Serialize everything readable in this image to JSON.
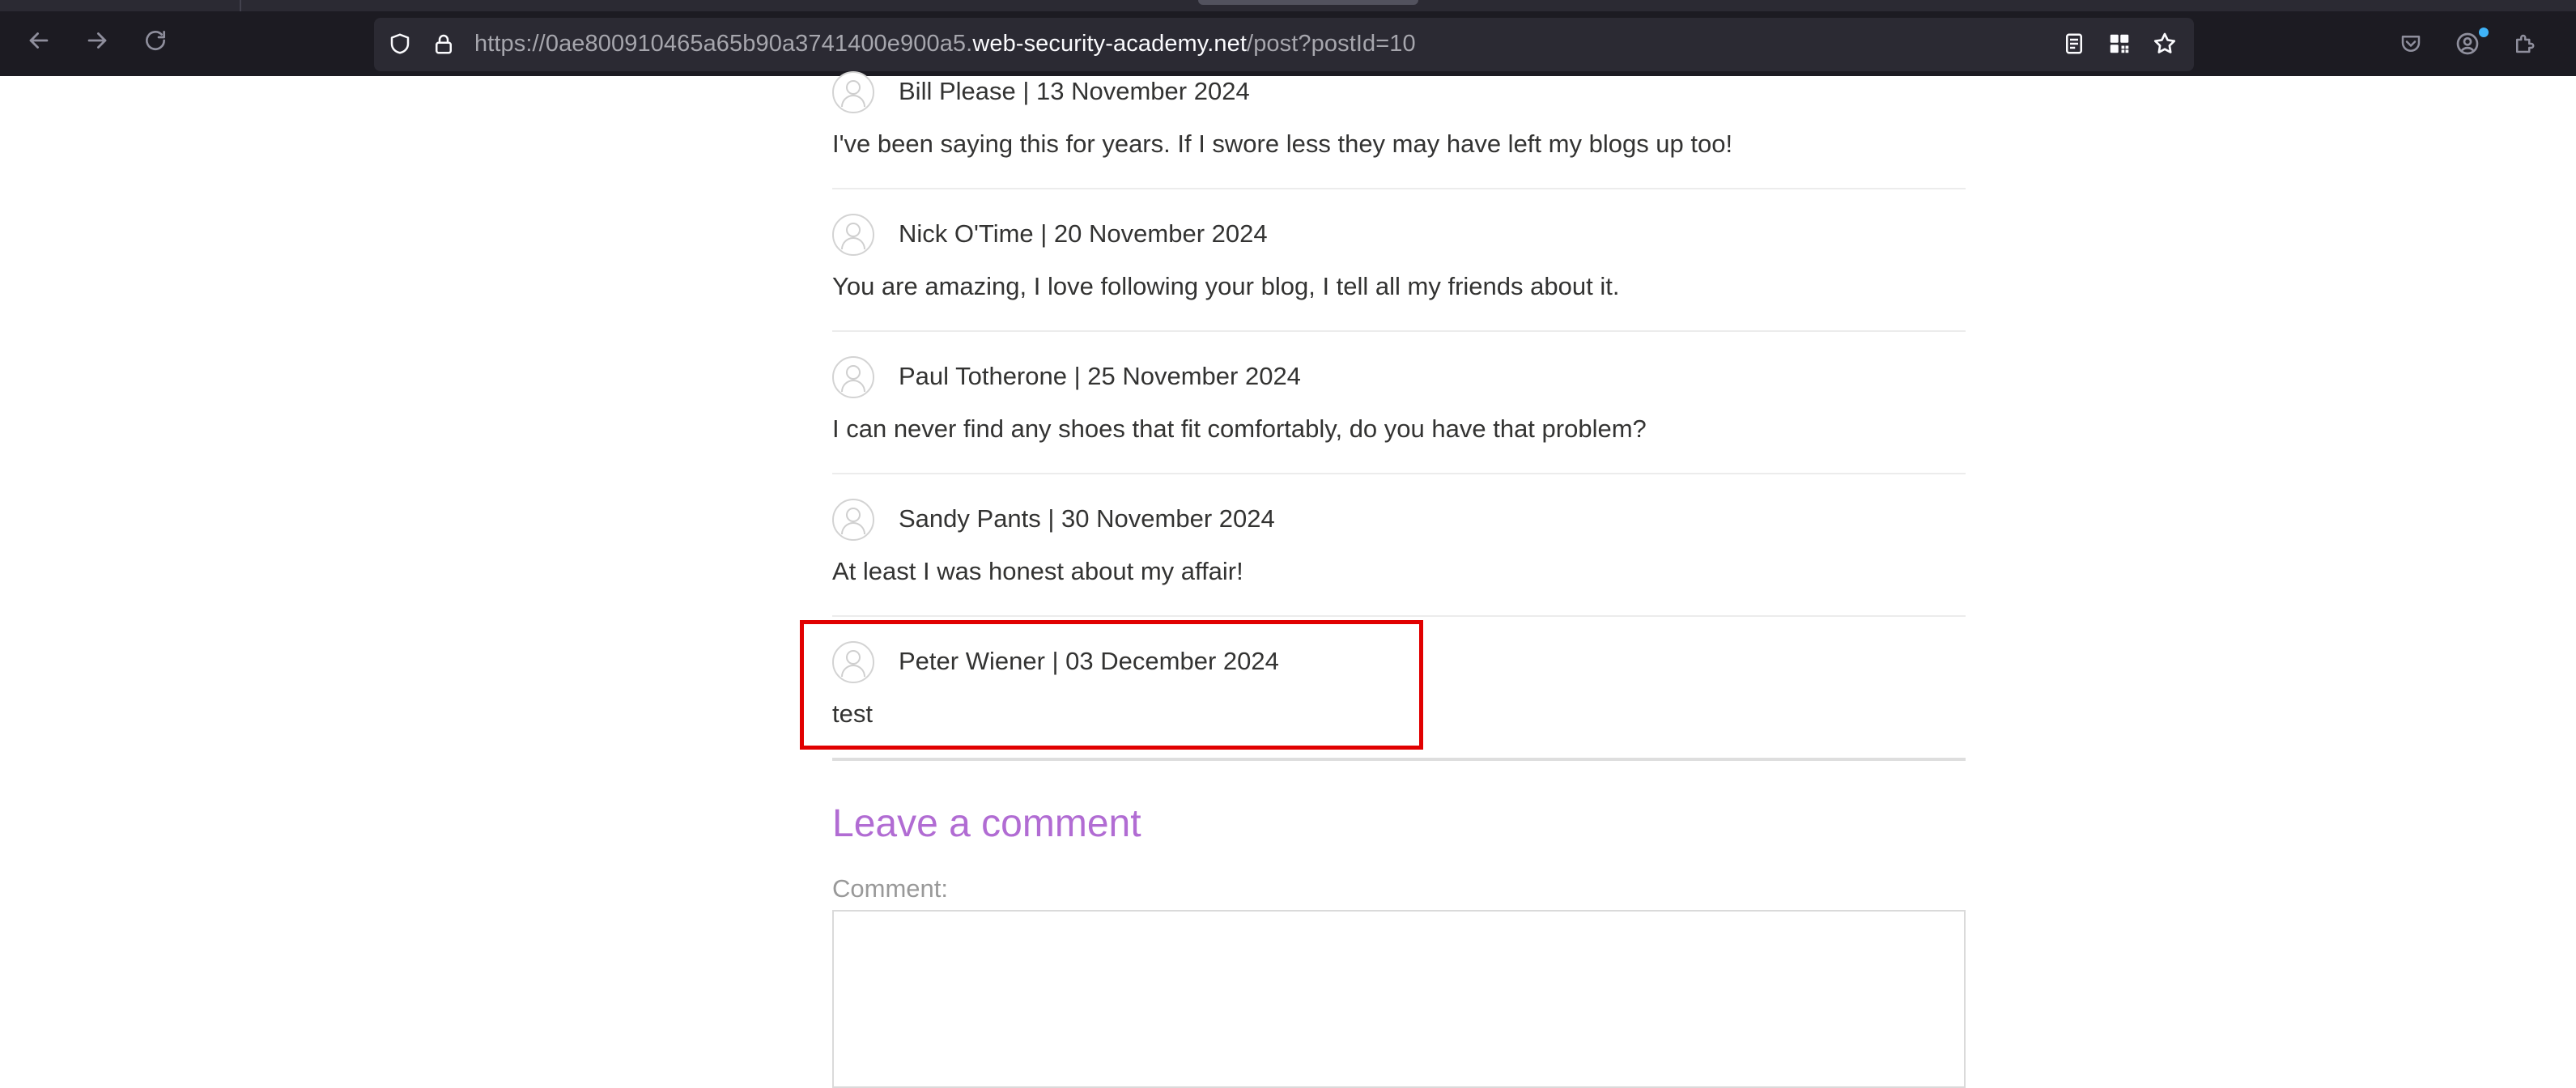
{
  "browser": {
    "url_prefix": "https://0ae800910465a65b90a3741400e900a5.",
    "url_domain": "web-security-academy.net",
    "url_path": "/post?postId=10",
    "toolbar_icons": [
      "back-arrow-icon",
      "forward-arrow-icon",
      "reload-icon",
      "shield-icon",
      "lock-icon",
      "reader-view-icon",
      "qr-code-icon",
      "bookmark-star-icon",
      "pocket-icon",
      "account-icon",
      "extensions-icon"
    ],
    "notification_color": "#3fb3f8"
  },
  "comments": [
    {
      "author_date": "Bill Please | 13 November 2024",
      "text": "I've been saying this for years. If I swore less they may have left my blogs up too!"
    },
    {
      "author_date": "Nick O'Time | 20 November 2024",
      "text": "You are amazing, I love following your blog, I tell all my friends about it."
    },
    {
      "author_date": "Paul Totherone | 25 November 2024",
      "text": "I can never find any shoes that fit comfortably, do you have that problem?"
    },
    {
      "author_date": "Sandy Pants | 30 November 2024",
      "text": "At least I was honest about my affair!"
    },
    {
      "author_date": "Peter Wiener | 03 December 2024",
      "text": "test"
    }
  ],
  "highlight_color": "#e10000",
  "leave_comment": {
    "title": "Leave a comment",
    "comment_label": "Comment:",
    "comment_value": "",
    "title_color": "#b16cd3"
  }
}
